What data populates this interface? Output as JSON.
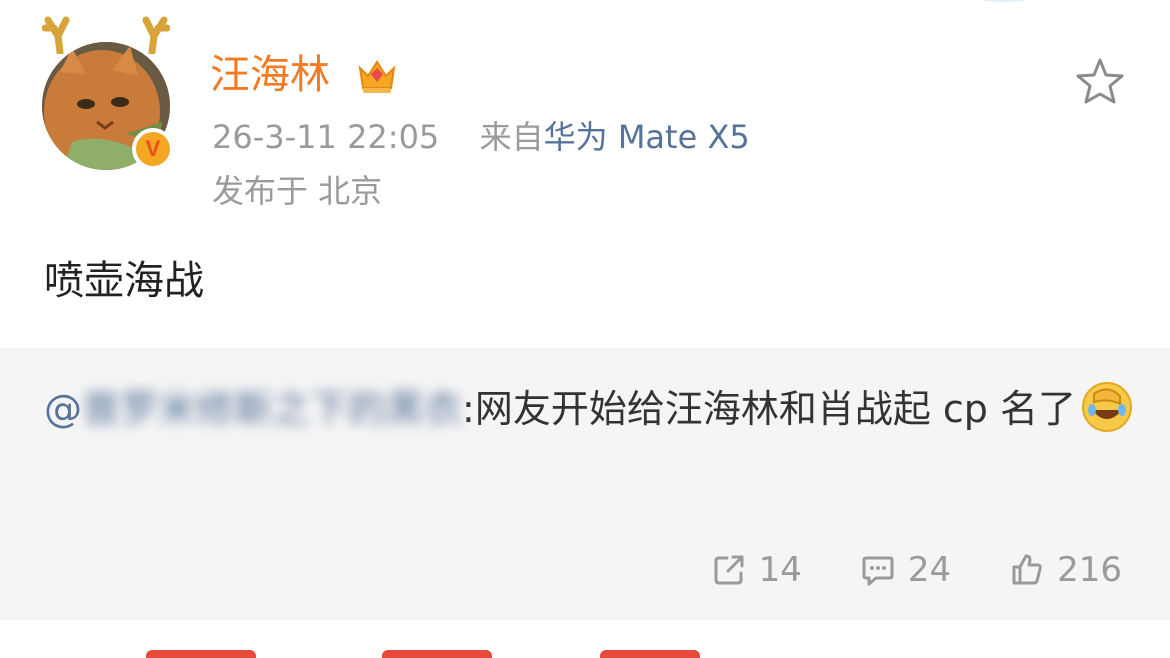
{
  "post": {
    "username": "汪海林",
    "time": "26-3-11 22:05",
    "source_prefix": "来自",
    "device": "华为 Mate X5",
    "location": "发布于 北京",
    "text": "喷壶海战"
  },
  "repost": {
    "mention_at": "@",
    "mention_name": "普罗米修斯之下的黑衣",
    "text": ":网友开始给汪海林和肖战起 cp 名了"
  },
  "actions": {
    "repost_count": "14",
    "comment_count": "24",
    "like_count": "216"
  },
  "icons": {
    "star": "star-outline-icon",
    "crown": "crown-icon",
    "verified": "verified-v-icon",
    "share": "share-icon",
    "comment": "comment-icon",
    "like": "thumbs-up-icon",
    "emoji": "facepalm-laugh-emoji"
  },
  "colors": {
    "username": "#f27a22",
    "link": "#57739a",
    "meta": "#9a9a9a",
    "repost_bg": "#f5f5f5"
  }
}
